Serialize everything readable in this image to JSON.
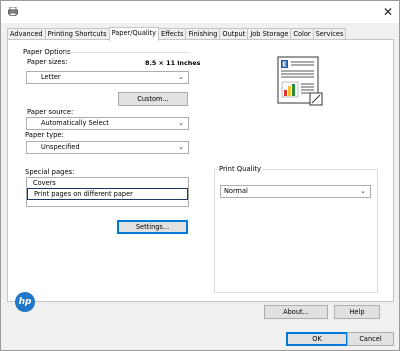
{
  "window": {
    "close_glyph": "✕",
    "icons": {
      "app": "printer-icon",
      "close": "close-icon"
    }
  },
  "tabs": [
    {
      "label": "Advanced",
      "active": false
    },
    {
      "label": "Printing Shortcuts",
      "active": false
    },
    {
      "label": "Paper/Quality",
      "active": true
    },
    {
      "label": "Effects",
      "active": false
    },
    {
      "label": "Finishing",
      "active": false
    },
    {
      "label": "Output",
      "active": false
    },
    {
      "label": "Job Storage",
      "active": false
    },
    {
      "label": "Color",
      "active": false
    },
    {
      "label": "Services",
      "active": false
    }
  ],
  "paper_options": {
    "group_label": "Paper Options",
    "paper_sizes_label": "Paper sizes:",
    "paper_size_dimensions": "8.5 × 11 inches",
    "paper_size_value": "Letter",
    "custom_button": "Custom...",
    "paper_source_label": "Paper source:",
    "paper_source_value": "Automatically Select",
    "paper_type_label": "Paper type:",
    "paper_type_value": "Unspecified"
  },
  "special_pages": {
    "label": "Special pages:",
    "items": [
      "Covers",
      "Print pages on different paper"
    ],
    "selected_index": 1,
    "settings_button": "Settings..."
  },
  "print_quality": {
    "group_label": "Print Quality",
    "value": "Normal"
  },
  "preview": {
    "page_letter": "E"
  },
  "buttons": {
    "about": "About...",
    "help": "Help",
    "ok": "OK",
    "cancel": "Cancel"
  },
  "logo": {
    "text": "hp"
  },
  "colors": {
    "accent": "#0078d7",
    "logo": "#1f78c8",
    "selected_border": "#1f3864"
  }
}
